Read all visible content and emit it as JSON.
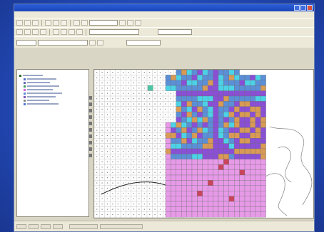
{
  "window": {
    "title": ""
  },
  "menu": [],
  "toc": {
    "layers": [
      {
        "icon": "check-box-icon",
        "color": "#2a6a2a"
      },
      {
        "icon": "layer-symbol-icon",
        "color": "#4f6fd0"
      },
      {
        "icon": "layer-symbol-icon",
        "color": "#6a6ab8"
      },
      {
        "icon": "layer-symbol-icon",
        "color": "#3d9a5b"
      },
      {
        "icon": "layer-symbol-icon",
        "color": "#d46ad0"
      },
      {
        "icon": "layer-symbol-icon",
        "color": "#5a8ad8"
      },
      {
        "icon": "layer-symbol-icon",
        "color": "#7a5ab8"
      },
      {
        "icon": "layer-symbol-icon",
        "color": "#8a8a8a"
      },
      {
        "icon": "layer-symbol-icon",
        "color": "#4a7ad0"
      }
    ],
    "frame_label": ""
  },
  "map": {
    "colors": {
      "blue": "#5b8fd7",
      "cyan": "#4cd2e6",
      "purple": "#8a4fd6",
      "orange": "#d89a55",
      "pink": "#e79ae8",
      "red": "#c8455b",
      "teal": "#49c7a6",
      "grid_line": "#b9b9b9"
    }
  }
}
